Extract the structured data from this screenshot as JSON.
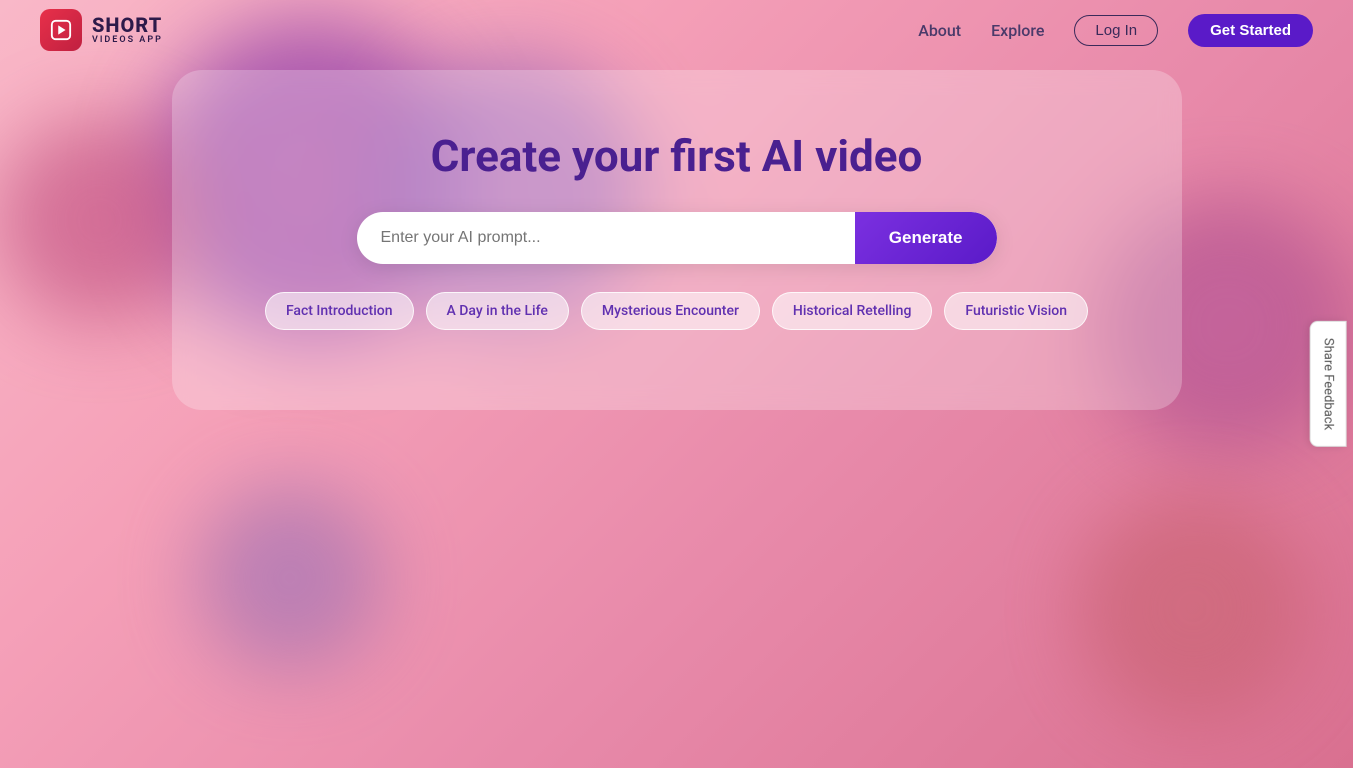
{
  "navbar": {
    "logo_short": "SHORT",
    "logo_sub": "VIDEOS APP",
    "links": [
      {
        "id": "about",
        "label": "About"
      },
      {
        "id": "explore",
        "label": "Explore"
      }
    ],
    "login_label": "Log In",
    "getstarted_label": "Get Started"
  },
  "hero": {
    "title": "Create your first AI video",
    "prompt_placeholder": "Enter your AI prompt...",
    "generate_label": "Generate"
  },
  "chips": [
    {
      "id": "fact-introduction",
      "label": "Fact Introduction"
    },
    {
      "id": "day-in-the-life",
      "label": "A Day in the Life"
    },
    {
      "id": "mysterious-encounter",
      "label": "Mysterious Encounter"
    },
    {
      "id": "historical-retelling",
      "label": "Historical Retelling"
    },
    {
      "id": "futuristic-vision",
      "label": "Futuristic Vision"
    }
  ],
  "feedback": {
    "label": "Share Feedback"
  },
  "colors": {
    "accent": "#5a1ac8",
    "hero_title": "#4a2090",
    "chip_text": "#6030b0"
  }
}
